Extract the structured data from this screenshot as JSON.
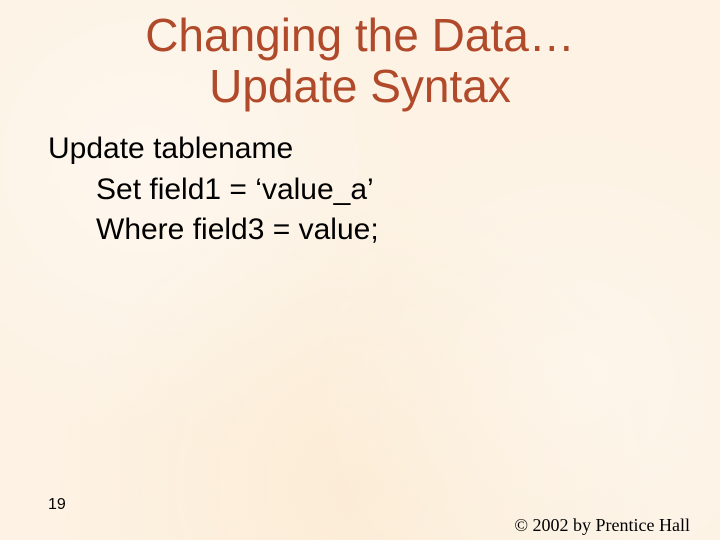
{
  "title": {
    "line1": "Changing the Data…",
    "line2": "Update Syntax"
  },
  "body": {
    "line1": "Update tablename",
    "line2": "Set field1 = ‘value_a’",
    "line3": "Where field3 = value;"
  },
  "footer": {
    "page_number": "19",
    "copyright": "© 2002 by Prentice Hall"
  }
}
